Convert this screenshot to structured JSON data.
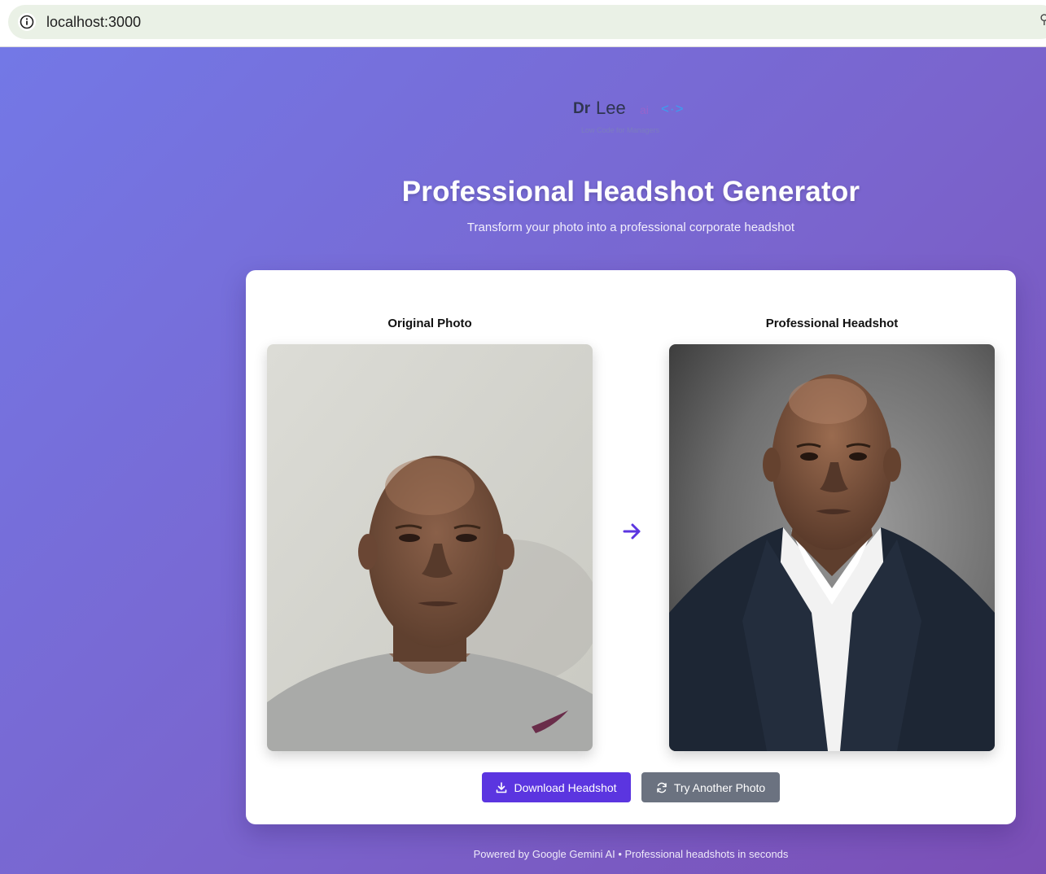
{
  "browser": {
    "url": "localhost:3000",
    "info_icon": "info-icon"
  },
  "logo": {
    "dr": "Dr",
    "lee": "Lee",
    "ai": "ai",
    "code": "<·>",
    "tagline": "Low Code for Managers"
  },
  "header": {
    "title": "Professional Headshot Generator",
    "subtitle": "Transform your photo into a professional corporate headshot"
  },
  "result": {
    "original_label": "Original Photo",
    "headshot_label": "Professional Headshot",
    "arrow_icon": "arrow-right-icon",
    "accent": "#5b35e0"
  },
  "actions": {
    "download_label": "Download Headshot",
    "download_icon": "download-icon",
    "retry_label": "Try Another Photo",
    "retry_icon": "refresh-icon",
    "secondary_color": "#6b7280"
  },
  "footer": {
    "text": "Powered by Google Gemini AI • Professional headshots in seconds"
  }
}
